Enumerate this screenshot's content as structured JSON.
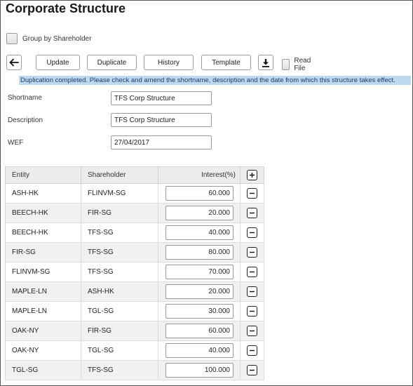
{
  "page": {
    "title": "Corporate Structure",
    "group_by_label": "Group by Shareholder",
    "group_by_checked": false
  },
  "toolbar": {
    "back_icon": "arrow-left-icon",
    "update_label": "Update",
    "duplicate_label": "Duplicate",
    "history_label": "History",
    "template_label": "Template",
    "download_icon": "download-icon",
    "read_file_label": "Read File",
    "read_file_checked": false
  },
  "message": {
    "text": "Duplication completed. Please check and amend the shortname, description and the date from which this structure takes effect.",
    "background": "#bcd9f0"
  },
  "form": {
    "shortname_label": "Shortname",
    "shortname_value": "TFS Corp Structure",
    "description_label": "Description",
    "description_value": "TFS Corp Structure",
    "wef_label": "WEF",
    "wef_value": "27/04/2017"
  },
  "table": {
    "headers": {
      "entity": "Entity",
      "shareholder": "Shareholder",
      "interest": "Interest(%)",
      "add_icon": "plus-icon"
    },
    "row_action_icon": "minus-icon",
    "rows": [
      {
        "entity": "ASH-HK",
        "shareholder": "FLINVM-SG",
        "interest": "60.000"
      },
      {
        "entity": "BEECH-HK",
        "shareholder": "FIR-SG",
        "interest": "20.000"
      },
      {
        "entity": "BEECH-HK",
        "shareholder": "TFS-SG",
        "interest": "40.000"
      },
      {
        "entity": "FIR-SG",
        "shareholder": "TFS-SG",
        "interest": "80.000"
      },
      {
        "entity": "FLINVM-SG",
        "shareholder": "TFS-SG",
        "interest": "70.000"
      },
      {
        "entity": "MAPLE-LN",
        "shareholder": "ASH-HK",
        "interest": "20.000"
      },
      {
        "entity": "MAPLE-LN",
        "shareholder": "TGL-SG",
        "interest": "30.000"
      },
      {
        "entity": "OAK-NY",
        "shareholder": "FIR-SG",
        "interest": "60.000"
      },
      {
        "entity": "OAK-NY",
        "shareholder": "TGL-SG",
        "interest": "40.000"
      },
      {
        "entity": "TGL-SG",
        "shareholder": "TFS-SG",
        "interest": "100.000"
      }
    ]
  }
}
